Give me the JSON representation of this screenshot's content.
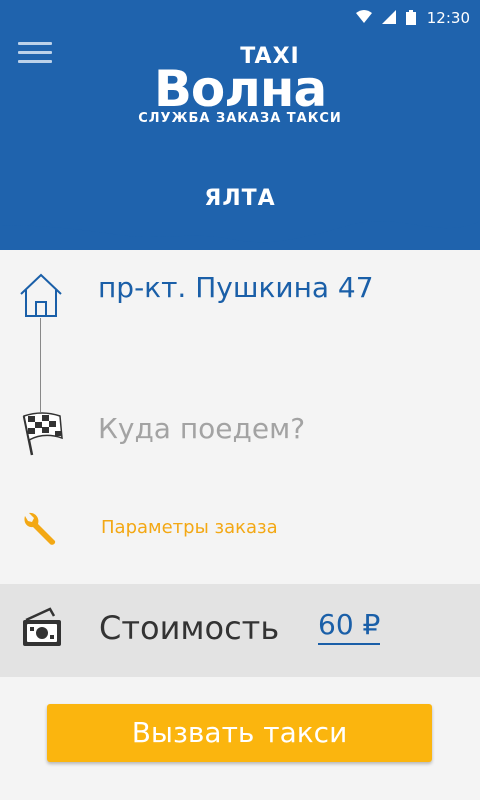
{
  "status_bar": {
    "time": "12:30",
    "icons": [
      "wifi-icon",
      "signal-icon",
      "battery-icon"
    ]
  },
  "header": {
    "menu_icon": "hamburger-menu-icon",
    "logo_taxi": "TAXI",
    "logo_name": "Волна",
    "logo_subtitle": "СЛУЖБА ЗАКАЗА ТАКСИ",
    "city": "ЯЛТА"
  },
  "route": {
    "from_icon": "house-icon",
    "from_address": "пр-кт. Пушкина 47",
    "to_icon": "checkered-flag-icon",
    "to_placeholder": "Куда поедем?"
  },
  "order_params": {
    "icon": "wrench-icon",
    "label": "Параметры заказа"
  },
  "cost": {
    "icon": "money-icon",
    "label": "Стоимость",
    "value": "60 ₽"
  },
  "call_button": {
    "label": "Вызвать такси"
  },
  "colors": {
    "header_blue": "#1f63ad",
    "accent_orange": "#fbb50e",
    "link_blue": "#1a5fa8",
    "params_orange": "#f3a814",
    "placeholder_gray": "#a3a3a3"
  }
}
